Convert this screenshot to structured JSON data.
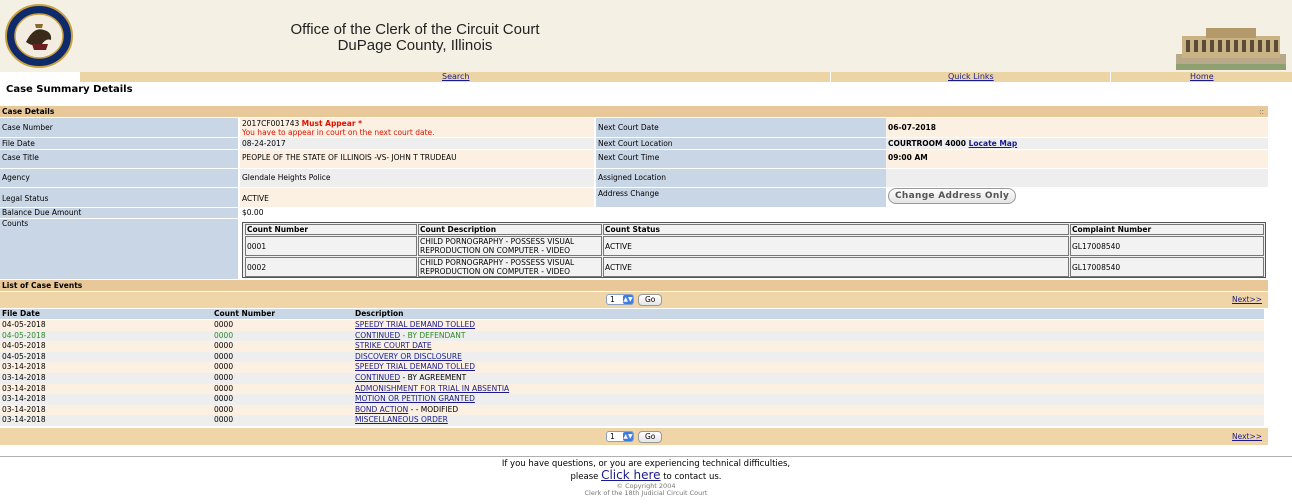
{
  "header": {
    "title_line1": "Office of the Clerk of the Circuit Court",
    "title_line2": "DuPage County, Illinois"
  },
  "nav": {
    "search": "Search",
    "quick_links": "Quick Links",
    "home": "Home"
  },
  "page_heading": "Case Summary Details",
  "case_details": {
    "section_title": "Case Details",
    "grip": "::",
    "case_number_label": "Case Number",
    "case_number": "2017CF001743",
    "must_appear": "Must Appear *",
    "must_appear_note": "You have to appear in court on the next court date.",
    "next_court_date_label": "Next Court Date",
    "next_court_date": "06-07-2018",
    "file_date_label": "File Date",
    "file_date": "08-24-2017",
    "next_court_location_label": "Next Court Location",
    "next_court_location": "COURTROOM 4000",
    "locate_map": "Locate Map",
    "case_title_label": "Case Title",
    "case_title": "PEOPLE OF THE STATE OF ILLINOIS -VS- JOHN T TRUDEAU",
    "next_court_time_label": "Next Court Time",
    "next_court_time": "09:00 AM",
    "agency_label": "Agency",
    "agency": "Glendale Heights Police",
    "assigned_location_label": "Assigned Location",
    "assigned_location": "",
    "legal_status_label": "Legal Status",
    "legal_status": "ACTIVE",
    "address_change_label": "Address Change",
    "change_address_button": "Change Address Only",
    "balance_due_label": "Balance Due Amount",
    "balance_due": "$0.00",
    "counts_label": "Counts"
  },
  "counts": {
    "headers": [
      "Count Number",
      "Count Description",
      "Count Status",
      "Complaint Number"
    ],
    "rows": [
      {
        "number": "0001",
        "desc1": "CHILD PORNOGRAPHY - POSSESS VISUAL",
        "desc2": "REPRODUCTION ON COMPUTER - VIDEO",
        "status": "ACTIVE",
        "complaint": "GL17008540"
      },
      {
        "number": "0002",
        "desc1": "CHILD PORNOGRAPHY - POSSESS VISUAL",
        "desc2": "REPRODUCTION ON COMPUTER - VIDEO",
        "status": "ACTIVE",
        "complaint": "GL17008540"
      }
    ]
  },
  "events": {
    "section_title": "List of Case Events",
    "page_value": "1",
    "go_label": "Go",
    "next_label": "Next>>",
    "headers": {
      "date": "File Date",
      "number": "Count Number",
      "desc": "Description"
    },
    "rows": [
      {
        "date": "04-05-2018",
        "number": "0000",
        "desc": "SPEEDY TRIAL DEMAND TOLLED",
        "extra": "",
        "green": false
      },
      {
        "date": "04-05-2018",
        "number": "0000",
        "desc": "CONTINUED",
        "extra": " - BY DEFENDANT",
        "green": true
      },
      {
        "date": "04-05-2018",
        "number": "0000",
        "desc": "STRIKE COURT DATE",
        "extra": "",
        "green": false
      },
      {
        "date": "04-05-2018",
        "number": "0000",
        "desc": "DISCOVERY OR DISCLOSURE",
        "extra": "",
        "green": false
      },
      {
        "date": "03-14-2018",
        "number": "0000",
        "desc": "SPEEDY TRIAL DEMAND TOLLED",
        "extra": "",
        "green": false
      },
      {
        "date": "03-14-2018",
        "number": "0000",
        "desc": "CONTINUED",
        "extra": " - BY AGREEMENT",
        "green": false
      },
      {
        "date": "03-14-2018",
        "number": "0000",
        "desc": "ADMONISHMENT FOR TRIAL IN ABSENTIA",
        "extra": "",
        "green": false
      },
      {
        "date": "03-14-2018",
        "number": "0000",
        "desc": "MOTION OR PETITION GRANTED",
        "extra": "",
        "green": false
      },
      {
        "date": "03-14-2018",
        "number": "0000",
        "desc": "BOND ACTION",
        "extra": " - - MODIFIED",
        "green": false
      },
      {
        "date": "03-14-2018",
        "number": "0000",
        "desc": "MISCELLANEOUS ORDER",
        "extra": "",
        "green": false
      }
    ]
  },
  "footer": {
    "line1": "If you have questions, or you are experiencing technical difficulties,",
    "please": "please",
    "click_here": "Click here",
    "to_contact": "to contact us.",
    "copyright": "© Copyright 2004",
    "clerk": "Clerk of the 18th Judicial Circuit Court"
  },
  "colors": {
    "nav_bar": "#ecd4a4",
    "section_bar": "#e8c898",
    "label_bg": "#c9d6e6",
    "alert_red": "#dd1100",
    "link_blue": "#1a1a8c"
  }
}
